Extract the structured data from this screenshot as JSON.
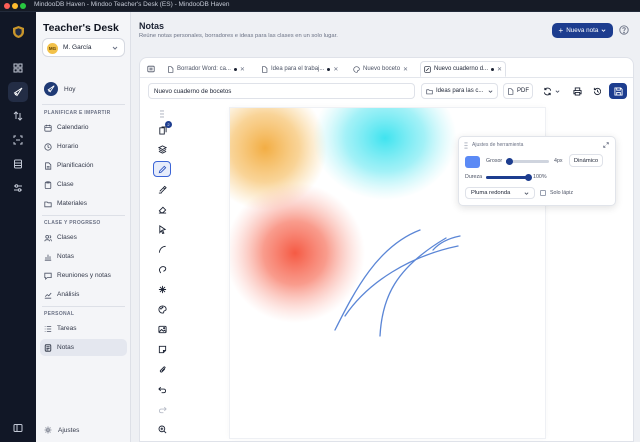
{
  "window": {
    "title": "MindooDB Haven - Mindoo Teacher's Desk (ES) - MindooDB Haven"
  },
  "colors": {
    "accent": "#1d3d8f",
    "rail": "#111726",
    "brush": "#5b8af5",
    "stroke": "#5b86d6"
  },
  "rail": {
    "icons": [
      "app-logo-icon",
      "dashboard-icon",
      "rocket-icon",
      "sync-icon",
      "scan-icon",
      "database-icon",
      "sliders-icon",
      "sidebar-toggle-icon"
    ]
  },
  "sidebar": {
    "brand": "Teacher's Desk",
    "user": {
      "initials": "MG",
      "name": "M. García"
    },
    "today": "Hoy",
    "section1": "Planificar e impartir",
    "plan_items": [
      {
        "label": "Calendario",
        "icon": "calendar-icon"
      },
      {
        "label": "Horario",
        "icon": "clock-icon"
      },
      {
        "label": "Planificación",
        "icon": "file-plan-icon"
      },
      {
        "label": "Clase",
        "icon": "clipboard-icon"
      },
      {
        "label": "Materiales",
        "icon": "folder-icon"
      }
    ],
    "section2": "Clase y progreso",
    "class_items": [
      {
        "label": "Clases",
        "icon": "users-icon"
      },
      {
        "label": "Notas",
        "icon": "bar-chart-icon"
      },
      {
        "label": "Reuniones y notas",
        "icon": "chat-icon"
      },
      {
        "label": "Análisis",
        "icon": "trend-icon"
      }
    ],
    "section3": "Personal",
    "personal_items": [
      {
        "label": "Tareas",
        "icon": "list-icon"
      },
      {
        "label": "Notas",
        "icon": "notes-icon"
      }
    ],
    "settings": "Ajustes"
  },
  "main": {
    "title": "Notas",
    "subtitle": "Reúne notas personales, borradores e ideas para las clases en un solo lugar.",
    "new_button": "Nueva nota",
    "tabs": [
      {
        "label": "Borrador Word: ca...",
        "dirty": true
      },
      {
        "label": "Idea para el trabaj...",
        "dirty": true
      },
      {
        "label": "Nuevo boceto",
        "dirty": false
      },
      {
        "label": "Nuevo cuaderno d...",
        "dirty": true
      }
    ],
    "doc_title": "Nuevo cuaderno de bocetos",
    "folder": "Ideas para las c...",
    "pdf_label": "PDF"
  },
  "tools": {
    "badge": "2"
  },
  "tool_settings": {
    "title": "Ajustes de herramienta",
    "thickness_label": "Grosor",
    "thickness_value": "4px",
    "thickness_fraction": 0.05,
    "dynamic_label": "Dinámico",
    "hardness_label": "Dureza",
    "hardness_value": "100%",
    "hardness_fraction": 1.0,
    "brush": "Pluma redonda",
    "pencil_only": "Solo lápiz"
  }
}
